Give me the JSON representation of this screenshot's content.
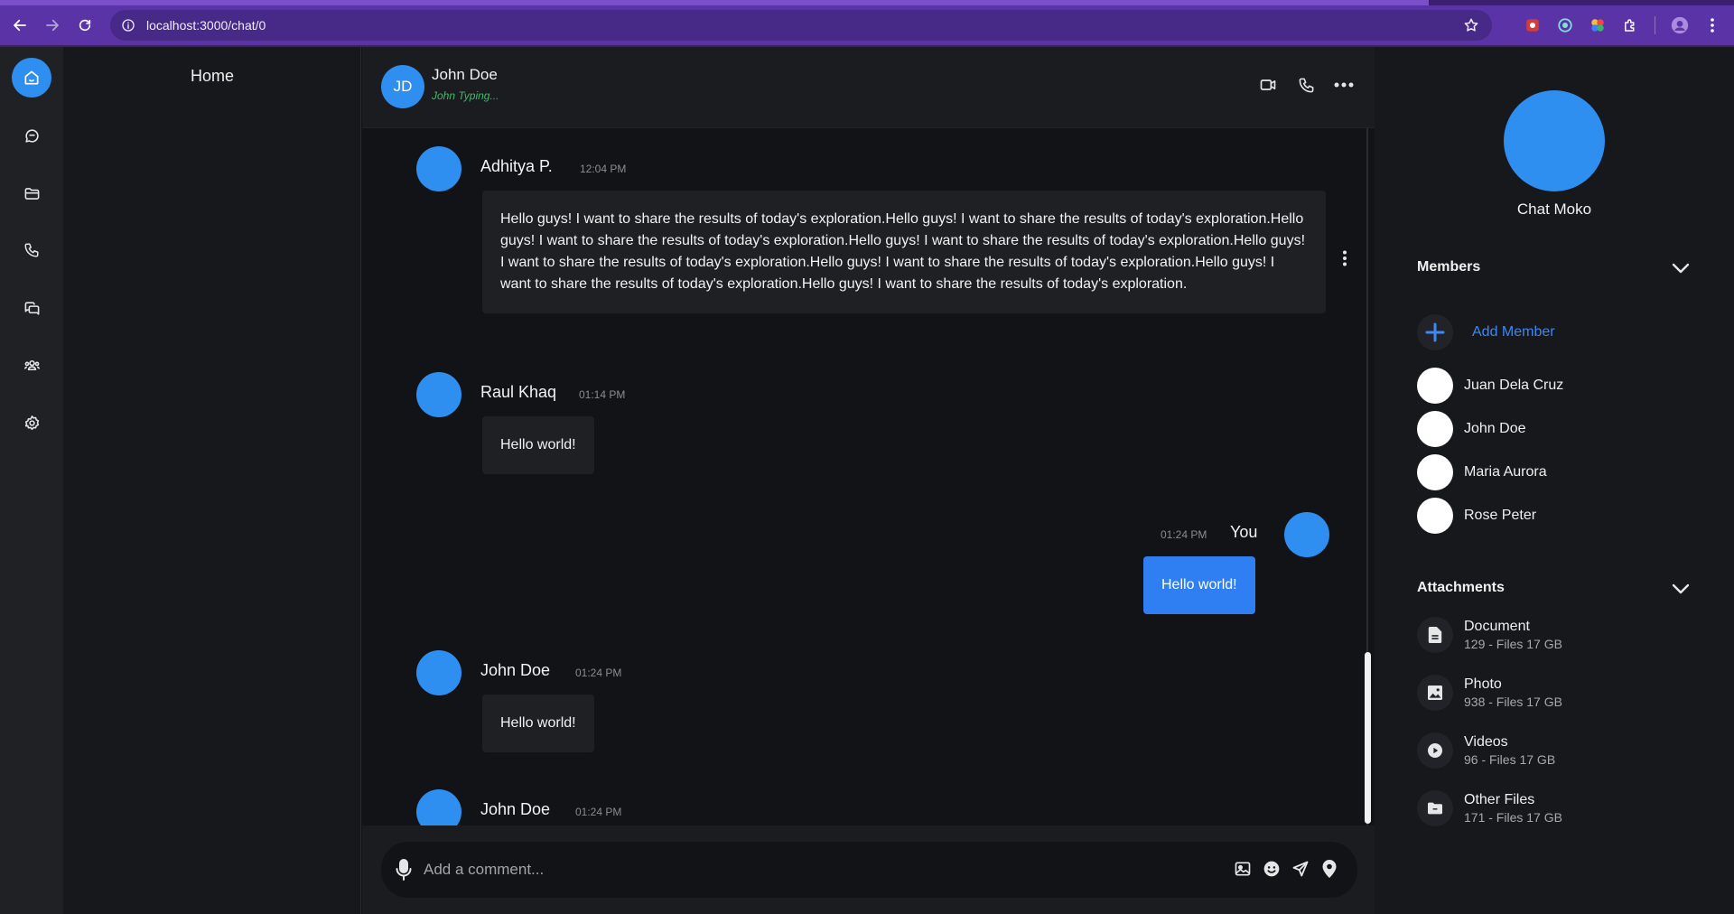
{
  "browser": {
    "url": "localhost:3000/chat/0",
    "back_icon": "arrow-left-icon",
    "forward_icon": "arrow-right-icon",
    "reload_icon": "reload-icon",
    "site_info_icon": "info-circle-icon",
    "bookmark_icon": "star-icon",
    "extensions": [
      "red-extension-icon",
      "teal-extension-icon",
      "colorful-extension-icon",
      "puzzle-icon",
      "profile-icon",
      "kebab-menu-icon"
    ]
  },
  "rail": {
    "items": [
      "home-icon",
      "chat-bubble-icon",
      "folder-icon",
      "phone-icon",
      "messages-icon",
      "users-icon",
      "settings-icon"
    ]
  },
  "left_pane": {
    "title": "Home"
  },
  "chat": {
    "header": {
      "initials": "JD",
      "name": "John Doe",
      "status": "John Typing...",
      "actions": [
        "video-icon",
        "phone-icon",
        "more-icon"
      ]
    },
    "messages": [
      {
        "sender": "Adhitya P.",
        "time": "12:04 PM",
        "text": "Hello guys! I want to share the results of today's exploration.Hello guys! I want to share the results of today's exploration.Hello guys! I want to share the results of today's exploration.Hello guys! I want to share the results of today's exploration.Hello guys! I want to share the results of today's exploration.Hello guys! I want to share the results of today's exploration.Hello guys! I want to share the results of today's exploration.Hello guys! I want to share the results of today's exploration.",
        "own": false
      },
      {
        "sender": "Raul Khaq",
        "time": "01:14 PM",
        "text": "Hello world!",
        "own": false
      },
      {
        "sender": "You",
        "time": "01:24 PM",
        "text": "Hello world!",
        "own": true
      },
      {
        "sender": "John Doe",
        "time": "01:24 PM",
        "text": "Hello world!",
        "own": false
      },
      {
        "sender": "John Doe",
        "time": "01:24 PM",
        "text": "",
        "own": false
      }
    ],
    "composer": {
      "placeholder": "Add a comment...",
      "actions": [
        "image-icon",
        "emoji-icon",
        "send-icon",
        "location-pin-icon"
      ]
    }
  },
  "info_panel": {
    "title": "Chat Moko",
    "members_title": "Members",
    "add_member_label": "Add Member",
    "members": [
      "Juan Dela Cruz",
      "John Doe",
      "Maria Aurora",
      "Rose Peter"
    ],
    "attachments_title": "Attachments",
    "attachments": [
      {
        "name": "Document",
        "meta": "129 - Files 17 GB",
        "icon": "document-icon"
      },
      {
        "name": "Photo",
        "meta": "938 - Files 17 GB",
        "icon": "photo-icon"
      },
      {
        "name": "Videos",
        "meta": "96 - Files 17 GB",
        "icon": "play-icon"
      },
      {
        "name": "Other Files",
        "meta": "171 - Files 17 GB",
        "icon": "folder-icon"
      }
    ]
  },
  "colors": {
    "accent": "#2f8ff0",
    "own_bubble": "#2f7ff2",
    "status": "#3dbb6a",
    "link": "#3d88f2"
  }
}
